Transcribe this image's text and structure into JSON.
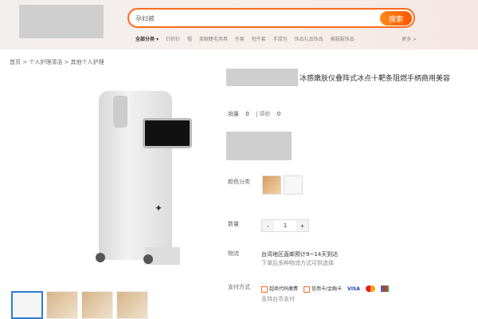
{
  "search": {
    "value": "孕妇裤",
    "button": "搜索"
  },
  "categories": {
    "all": "全部分类 ▾",
    "items": [
      "针织衫",
      "帽",
      "美眼睫毛用具",
      "外套",
      "短外套",
      "手提包",
      "饰品礼品饰品",
      "棉服服饰品"
    ],
    "more": "更多 >"
  },
  "breadcrumb": "首页 > 个人护理清洁 > 其他个人护理",
  "product": {
    "title": "冰感嫩肤仪叠阵式冰点十靶条阻燃手柄商用美容",
    "sales_label": "销量",
    "sales": "0",
    "review_label": "评价",
    "reviews": "0",
    "color_label": "颜色分类",
    "quantity_label": "数量",
    "quantity": "1",
    "minus": "-",
    "plus": "+",
    "shipping_label": "物流",
    "shipping_main": "台湾地区直邮预计9~14天到达",
    "shipping_note": "下单后多种物流方式可供选择",
    "payment_label": "支付方式",
    "payment_methods": [
      "超商代码缴费",
      "信用卡/金融卡"
    ],
    "payment_sub": "支持台币支付"
  },
  "icons": {
    "search": "search-icon",
    "visa": "VISA",
    "mastercard": "mastercard-icon",
    "jcb": "JCB"
  },
  "colors": {
    "accent": "#ff6a1f",
    "thumb_active": "#2d7bd6"
  }
}
